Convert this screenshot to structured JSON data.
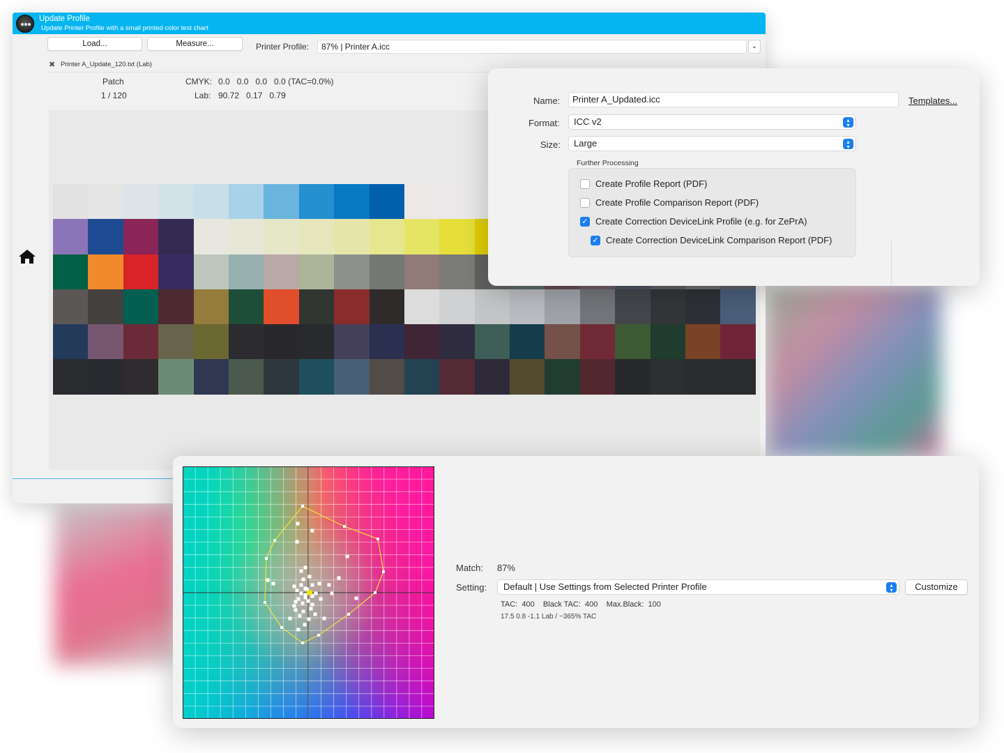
{
  "window": {
    "title": "Update Profile",
    "subtitle": "Update Printer Profile with a small printed color test chart"
  },
  "toolbar": {
    "load_label": "Load...",
    "measure_label": "Measure...",
    "printer_profile_label": "Printer Profile:",
    "printer_profile_value": "87% | Printer A.icc"
  },
  "file": {
    "name": "Printer A_Update_120.txt (Lab)"
  },
  "patch_info": {
    "patch_label": "Patch",
    "patch_value": "1 / 120",
    "cmyk_label": "CMYK:",
    "cmyk_values": "0.0   0.0   0.0   0.0 (TAC=0.0%)",
    "lab_label": "Lab:",
    "lab_values": "90.72   0.17   0.79"
  },
  "patches": [
    [
      "#e2e2e2",
      "#e4e5e4",
      "#dde3e6",
      "#d3e2e8",
      "#c8dee8",
      "#a8d2e8",
      "#6ab5dd",
      "#2590cf",
      "#0779c3",
      "#0060ab",
      "#ece8e8",
      "#ebe8e9",
      "#e8e8e8",
      "#e8e8e8",
      "#e8e8e8",
      "#e8e8e8",
      "#e8e8e8",
      "#e8e8e8",
      "#e8e8e8",
      "#e8e8e8"
    ],
    [
      "#8c75b7",
      "#1e4a92",
      "#8b2558",
      "#352b52",
      "#e7e7df",
      "#e7e7d8",
      "#e6e6c8",
      "#e6e6bd",
      "#e6e6aa",
      "#e5e68f",
      "#e6e465",
      "#e6df3a",
      "#e0cf05",
      "#d8c4b4",
      "#b89aaa",
      "#d47a9c",
      "#c9689a",
      "#c1a3b8",
      "#9a9fb3",
      "#7b849e"
    ],
    [
      "#006045",
      "#f08a2c",
      "#d82328",
      "#372d60",
      "#bcc6bc",
      "#97b0ad",
      "#b8a8a6",
      "#adb49a",
      "#8b908b",
      "#737873",
      "#907b79",
      "#7b7c78",
      "#606261",
      "#5b6a64",
      "#6a4a53",
      "#6e5a63",
      "#4f5462",
      "#5d5f62",
      "#6b6f6e",
      "#5b6066"
    ],
    [
      "#5a5754",
      "#43403f",
      "#005f4f",
      "#4d2b31",
      "#957b3c",
      "#1d4e37",
      "#e04e2b",
      "#303532",
      "#8b2c2c",
      "#302b2b",
      "#dcdcdc",
      "#d0d1d2",
      "#c4c5c6",
      "#b9bcc0",
      "#9fa3a9",
      "#727579",
      "#43464b",
      "#343539",
      "#2e3036",
      "#4a5e79"
    ],
    [
      "#233a5b",
      "#77566f",
      "#6b2a37",
      "#66654b",
      "#6a6730",
      "#2b2b30",
      "#29292d",
      "#292a2e",
      "#45405a",
      "#2b3050",
      "#3f2535",
      "#302c3f",
      "#3f5e58",
      "#153c4a",
      "#745149",
      "#702a36",
      "#3c5a33",
      "#1f3c2e",
      "#784327",
      "#6f2537"
    ],
    [
      "#2a2b2f",
      "#282a2f",
      "#2f2b2e",
      "#6c8b74",
      "#2f3751",
      "#4b5a4c",
      "#2e393f",
      "#1f4f5c",
      "#486077",
      "#524b48",
      "#234350",
      "#542b35",
      "#2f2a3a",
      "#544b30",
      "#213d31",
      "#53282f",
      "#28292d",
      "#2d2e31",
      "#2b2c2f",
      "#2a2b2e"
    ]
  ],
  "dialog": {
    "name_label": "Name:",
    "name_value": "Printer A_Updated.icc",
    "templates_label": "Templates...",
    "format_label": "Format:",
    "format_value": "ICC v2",
    "size_label": "Size:",
    "size_value": "Large",
    "further_processing_label": "Further Processing",
    "options": [
      {
        "label": "Create Profile Report (PDF)",
        "checked": false
      },
      {
        "label": "Create Profile Comparison Report (PDF)",
        "checked": false
      },
      {
        "label": "Create Correction DeviceLink Profile (e.g. for ZePrA)",
        "checked": true
      },
      {
        "label": "Create Correction DeviceLink Comparison Report (PDF)",
        "checked": true
      }
    ]
  },
  "gamut": {
    "match_label": "Match:",
    "match_value": "87%",
    "setting_label": "Setting:",
    "setting_value": "Default | Use Settings from Selected Printer Profile",
    "customize_label": "Customize",
    "tac_line": "TAC:  400    Black TAC:  400    Max.Black:  100",
    "lab_line": "17.5 0.8 -1.1 Lab / ~365% TAC",
    "colors": {
      "outline": "#f2e23c",
      "points": "#ffffff",
      "marker": "#f2e600"
    }
  }
}
